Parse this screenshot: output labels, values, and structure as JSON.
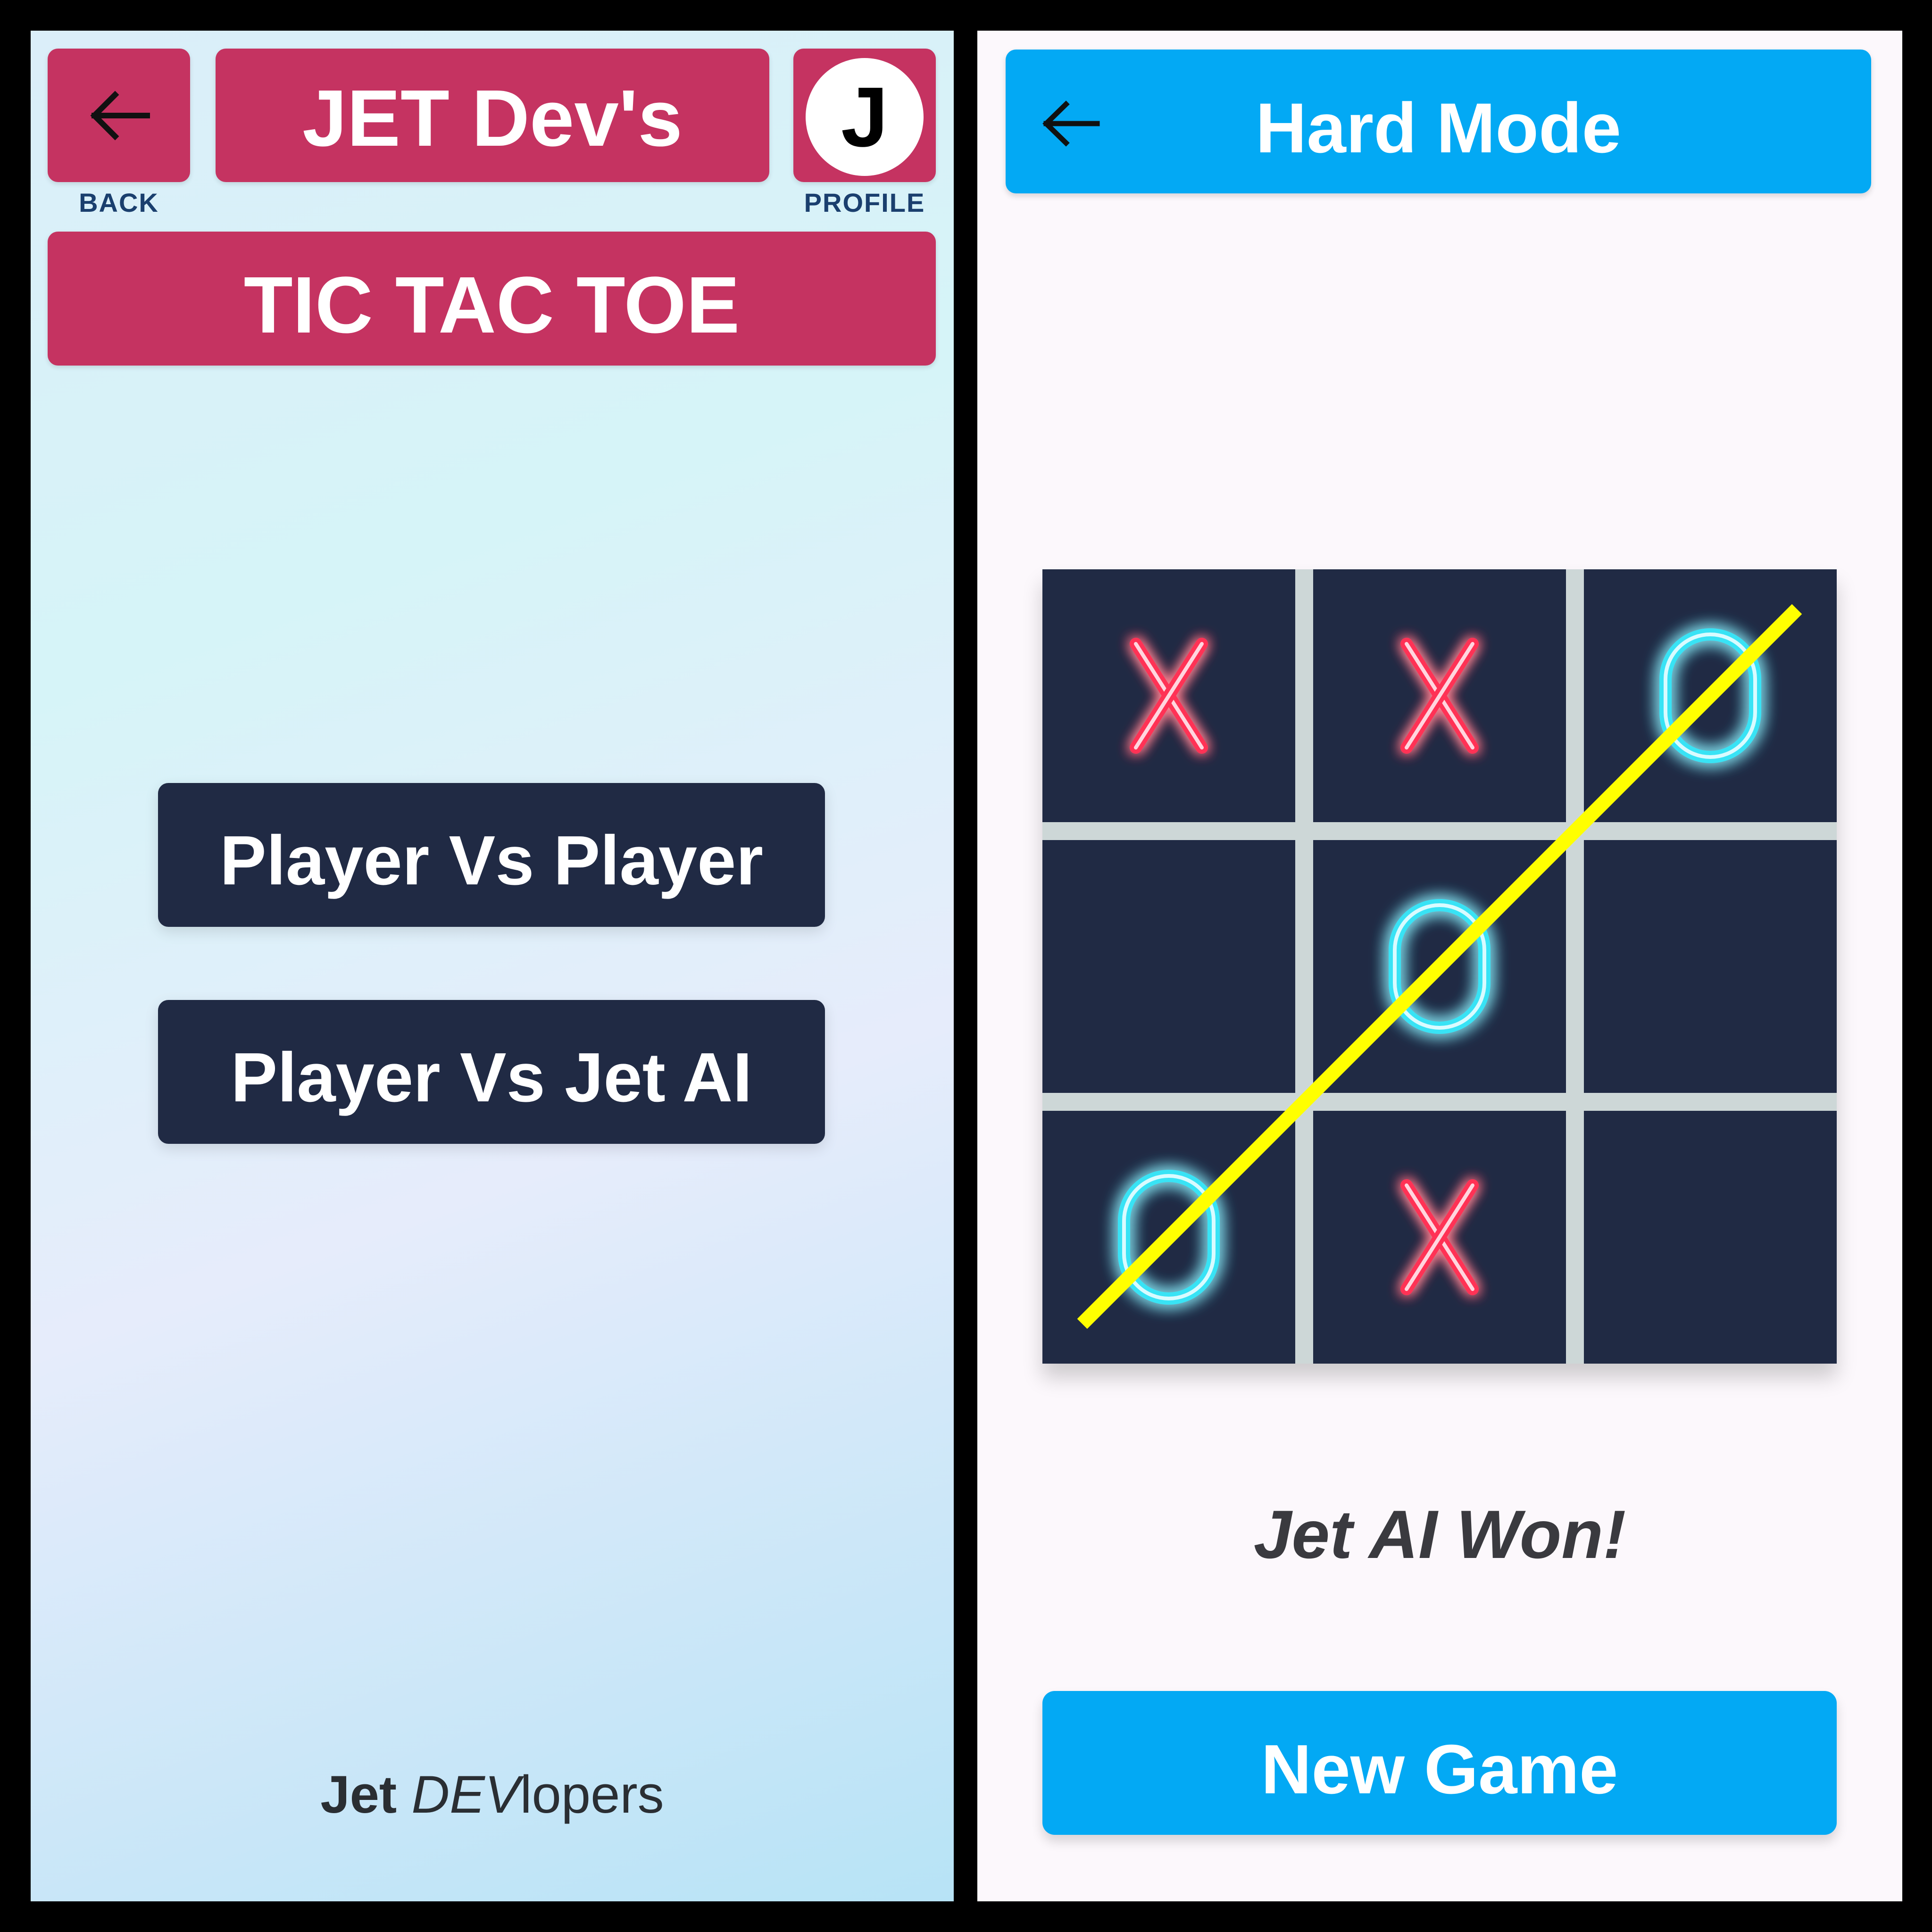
{
  "left_screen": {
    "back_caption": "BACK",
    "app_title": "JET Dev's",
    "profile_initial": "J",
    "profile_caption": "PROFILE",
    "game_title": "TIC TAC TOE",
    "modes": [
      "Player Vs Player",
      "Player Vs Jet AI"
    ],
    "credit": {
      "bold": "Jet",
      "italic": "DEV",
      "rest": "lopers"
    }
  },
  "right_screen": {
    "header_title": "Hard Mode",
    "board": [
      "X",
      "X",
      "O",
      "",
      "O",
      "",
      "O",
      "X",
      ""
    ],
    "winning_line": [
      6,
      4,
      2
    ],
    "result_text": "Jet AI Won!",
    "new_game_label": "New Game"
  },
  "colors": {
    "pink": "#c53361",
    "navy": "#202a44",
    "blue": "#03a9f4",
    "x_mark": "#ff3355",
    "o_mark": "#38e3f5",
    "win_line": "#ffff00"
  },
  "icons": [
    "back-arrow-icon",
    "back-arrow-icon"
  ]
}
